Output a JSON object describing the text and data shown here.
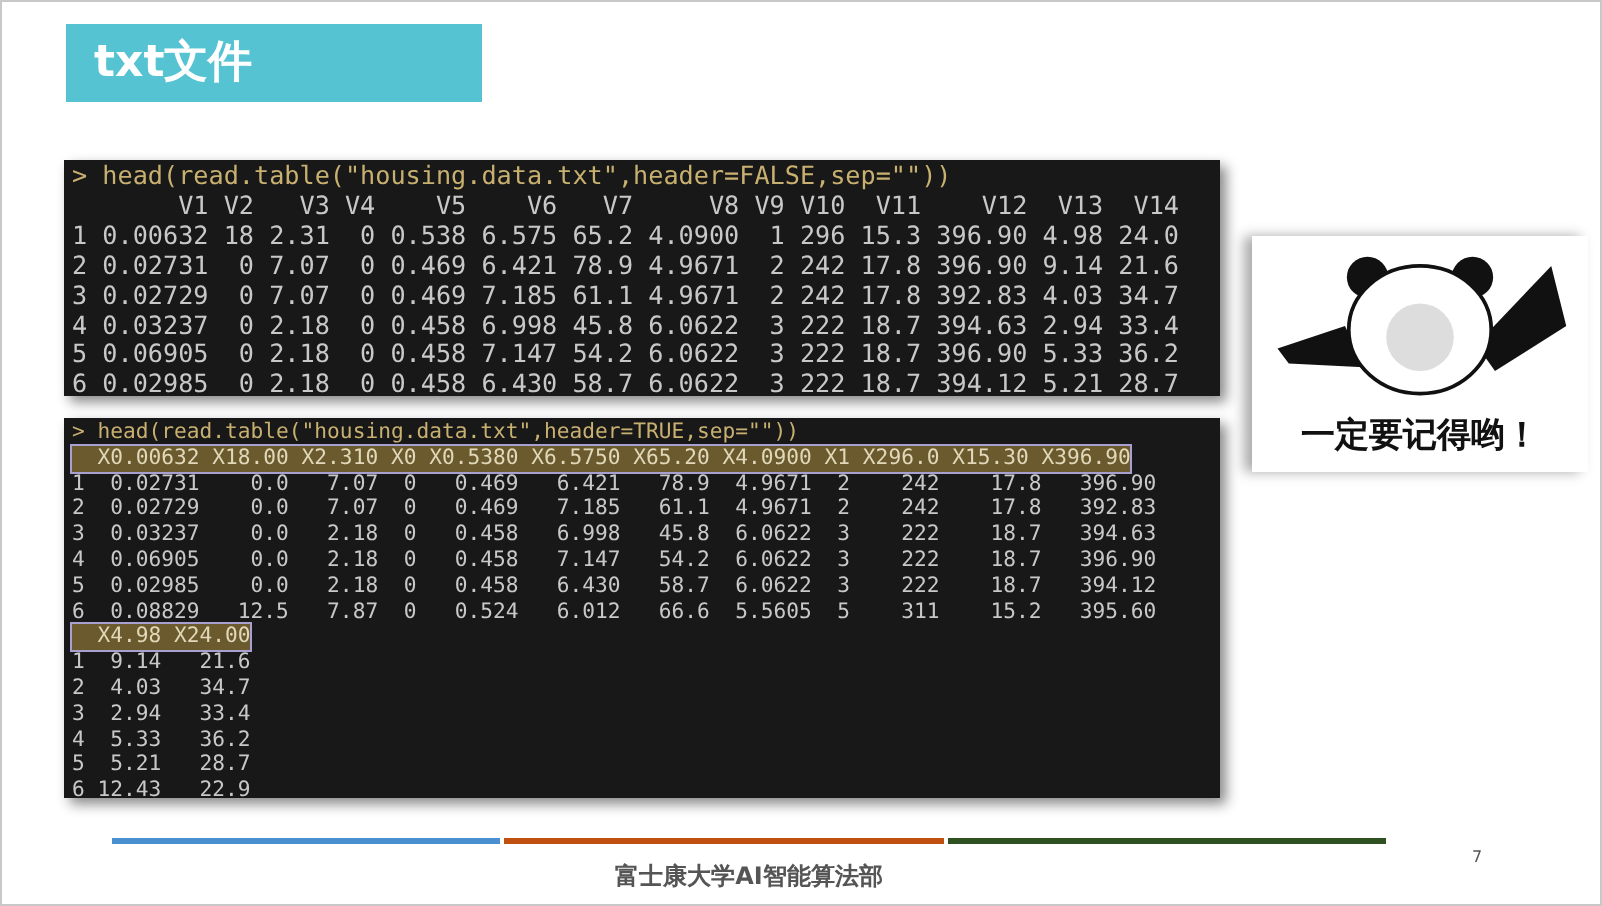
{
  "title": "txt文件",
  "consoles": [
    {
      "lines": [
        {
          "kind": "command",
          "text": "> head(read.table(\"housing.data.txt\",header=FALSE,sep=\"\"))"
        },
        {
          "kind": "output",
          "text": "       V1 V2   V3 V4    V5    V6   V7     V8 V9 V10  V11    V12  V13  V14"
        },
        {
          "kind": "output",
          "text": "1 0.00632 18 2.31  0 0.538 6.575 65.2 4.0900  1 296 15.3 396.90 4.98 24.0"
        },
        {
          "kind": "output",
          "text": "2 0.02731  0 7.07  0 0.469 6.421 78.9 4.9671  2 242 17.8 396.90 9.14 21.6"
        },
        {
          "kind": "output",
          "text": "3 0.02729  0 7.07  0 0.469 7.185 61.1 4.9671  2 242 17.8 392.83 4.03 34.7"
        },
        {
          "kind": "output",
          "text": "4 0.03237  0 2.18  0 0.458 6.998 45.8 6.0622  3 222 18.7 394.63 2.94 33.4"
        },
        {
          "kind": "output",
          "text": "5 0.06905  0 2.18  0 0.458 7.147 54.2 6.0622  3 222 18.7 396.90 5.33 36.2"
        },
        {
          "kind": "output",
          "text": "6 0.02985  0 2.18  0 0.458 6.430 58.7 6.0622  3 222 18.7 394.12 5.21 28.7"
        }
      ]
    },
    {
      "lines": [
        {
          "kind": "command",
          "text": "> head(read.table(\"housing.data.txt\",header=TRUE,sep=\"\"))"
        },
        {
          "kind": "header",
          "text": "  X0.00632 X18.00 X2.310 X0 X0.5380 X6.5750 X65.20 X4.0900 X1 X296.0 X15.30 X396.90"
        },
        {
          "kind": "output",
          "text": "1  0.02731    0.0   7.07  0   0.469   6.421   78.9  4.9671  2    242    17.8   396.90"
        },
        {
          "kind": "output",
          "text": "2  0.02729    0.0   7.07  0   0.469   7.185   61.1  4.9671  2    242    17.8   392.83"
        },
        {
          "kind": "output",
          "text": "3  0.03237    0.0   2.18  0   0.458   6.998   45.8  6.0622  3    222    18.7   394.63"
        },
        {
          "kind": "output",
          "text": "4  0.06905    0.0   2.18  0   0.458   7.147   54.2  6.0622  3    222    18.7   396.90"
        },
        {
          "kind": "output",
          "text": "5  0.02985    0.0   2.18  0   0.458   6.430   58.7  6.0622  3    222    18.7   394.12"
        },
        {
          "kind": "output",
          "text": "6  0.08829   12.5   7.87  0   0.524   6.012   66.6  5.5605  5    311    15.2   395.60"
        },
        {
          "kind": "header",
          "text": "  X4.98 X24.00"
        },
        {
          "kind": "output",
          "text": "1  9.14   21.6"
        },
        {
          "kind": "output",
          "text": "2  4.03   34.7"
        },
        {
          "kind": "output",
          "text": "3  2.94   33.4"
        },
        {
          "kind": "output",
          "text": "4  5.33   36.2"
        },
        {
          "kind": "output",
          "text": "5  5.21   28.7"
        },
        {
          "kind": "output",
          "text": "6 12.43   22.9"
        }
      ]
    }
  ],
  "meme": {
    "caption": "一定要记得哟！"
  },
  "footer": {
    "text": "富士康大学AI智能算法部",
    "page": "7"
  }
}
